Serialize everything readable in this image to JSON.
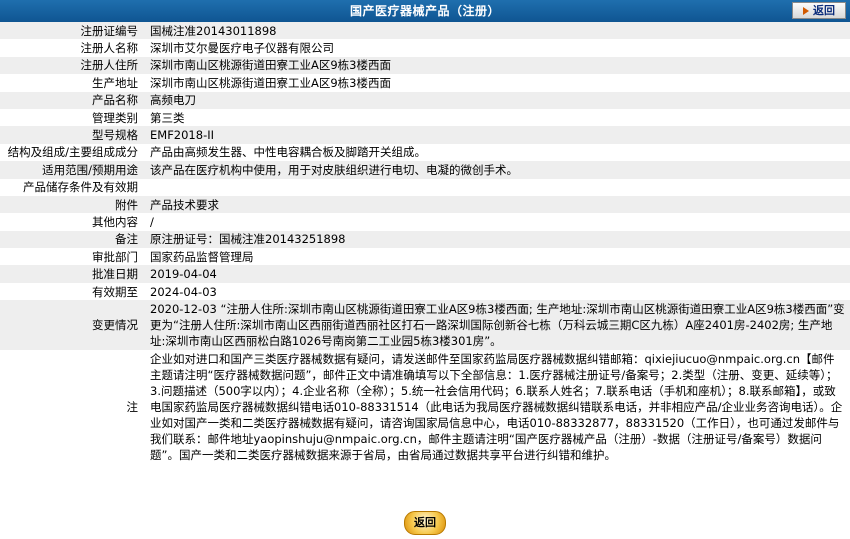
{
  "header": {
    "title": "国产医疗器械产品（注册）",
    "back_label": "返回"
  },
  "rows": [
    {
      "label": "注册证编号",
      "value": "国械注准20143011898"
    },
    {
      "label": "注册人名称",
      "value": "深圳市艾尔曼医疗电子仪器有限公司"
    },
    {
      "label": "注册人住所",
      "value": "深圳市南山区桃源街道田寮工业A区9栋3楼西面"
    },
    {
      "label": "生产地址",
      "value": "深圳市南山区桃源街道田寮工业A区9栋3楼西面"
    },
    {
      "label": "产品名称",
      "value": "高频电刀"
    },
    {
      "label": "管理类别",
      "value": "第三类"
    },
    {
      "label": "型号规格",
      "value": "EMF2018-II"
    },
    {
      "label": "结构及组成/主要组成成分",
      "value": "产品由高频发生器、中性电容耦合板及脚踏开关组成。"
    },
    {
      "label": "适用范围/预期用途",
      "value": "该产品在医疗机构中使用，用于对皮肤组织进行电切、电凝的微创手术。"
    },
    {
      "label": "产品储存条件及有效期",
      "value": ""
    },
    {
      "label": "附件",
      "value": "产品技术要求"
    },
    {
      "label": "其他内容",
      "value": "/"
    },
    {
      "label": "备注",
      "value": "原注册证号：国械注准20143251898"
    },
    {
      "label": "审批部门",
      "value": "国家药品监督管理局"
    },
    {
      "label": "批准日期",
      "value": "2019-04-04"
    },
    {
      "label": "有效期至",
      "value": "2024-04-03"
    },
    {
      "label": "变更情况",
      "value": "2020-12-03 “注册人住所:深圳市南山区桃源街道田寮工业A区9栋3楼西面; 生产地址:深圳市南山区桃源街道田寮工业A区9栋3楼西面”变更为“注册人住所:深圳市南山区西丽街道西丽社区打石一路深圳国际创新谷七栋（万科云城三期C区九栋）A座2401房-2402房; 生产地址:深圳市南山区西丽松白路1026号南岗第二工业园5栋3楼301房”。"
    },
    {
      "label": "注",
      "value": "企业如对进口和国产三类医疗器械数据有疑问，请发送邮件至国家药监局医疗器械数据纠错邮箱：qixiejiucuo@nmpaic.org.cn【邮件主题请注明“医疗器械数据问题”，邮件正文中请准确填写以下全部信息：1.医疗器械注册证号/备案号；2.类型（注册、变更、延续等）；3.问题描述（500字以内）；4.企业名称（全称）；5.统一社会信用代码；6.联系人姓名；7.联系电话（手机和座机）；8.联系邮箱】，或致电国家药监局医疗器械数据纠错电话010-88331514（此电话为我局医疗器械数据纠错联系电话，并非相应产品/企业业务咨询电话）。企业如对国产一类和二类医疗器械数据有疑问，请咨询国家局信息中心，电话010-88332877，88331520（工作日），也可通过发邮件与我们联系：邮件地址yaopinshuju@nmpaic.org.cn，邮件主题请注明“国产医疗器械产品（注册）-数据（注册证号/备案号）数据问题”。国产一类和二类医疗器械数据来源于省局，由省局通过数据共享平台进行纠错和维护。"
    }
  ],
  "footer": {
    "back_label": "返回"
  }
}
